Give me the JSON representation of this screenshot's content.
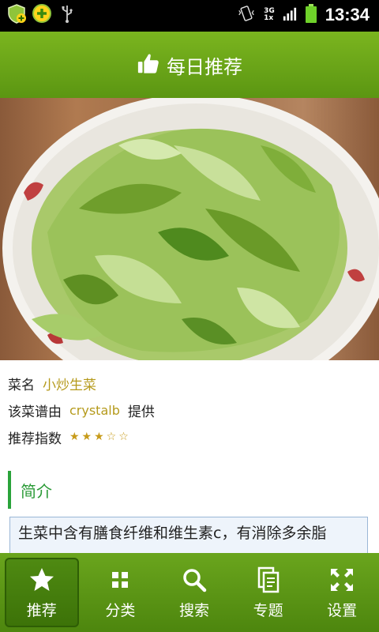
{
  "status_bar": {
    "time": "13:34",
    "net_top": "3G",
    "net_bottom": "1x"
  },
  "header": {
    "title": "每日推荐",
    "icon": "thumbs-up-icon"
  },
  "recipe": {
    "name_label": "菜名",
    "name_value": "小炒生菜",
    "provider_prefix": "该菜谱由",
    "provider_name": "crystalb",
    "provider_suffix": "提供",
    "rating_label": "推荐指数",
    "rating_stars": "★★★☆☆",
    "rating_value": 3,
    "rating_max": 5
  },
  "intro": {
    "heading": "简介",
    "text": "生菜中含有膳食纤维和维生素c，有消除多余脂"
  },
  "tabs": [
    {
      "label": "推荐",
      "icon": "star-icon",
      "active": true
    },
    {
      "label": "分类",
      "icon": "grid-icon",
      "active": false
    },
    {
      "label": "搜索",
      "icon": "search-icon",
      "active": false
    },
    {
      "label": "专题",
      "icon": "documents-icon",
      "active": false
    },
    {
      "label": "设置",
      "icon": "expand-arrows-icon",
      "active": false
    }
  ],
  "colors": {
    "accent_green": "#5b9612",
    "intro_green": "#2aa33a",
    "highlight_gold": "#b59a1b"
  }
}
